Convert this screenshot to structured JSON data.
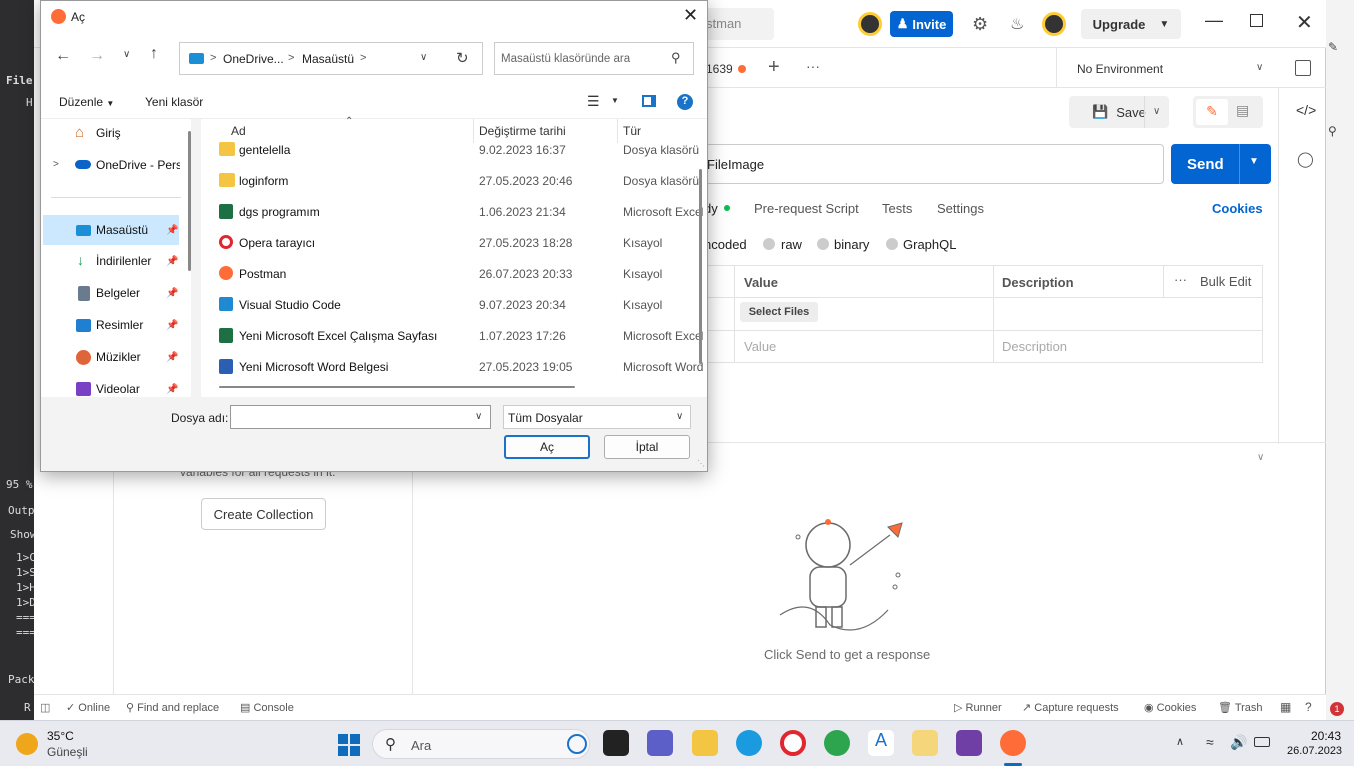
{
  "vs": {
    "file_label": "File",
    "h_label": "H",
    "zoom": "95 %",
    "output_label": "Outp",
    "show_label": "Show",
    "lines": [
      "1>C",
      "1>S",
      "1>H",
      "1>D",
      "===",
      "==="
    ],
    "pack_label": "Pack",
    "r_label": "R"
  },
  "postman": {
    "top_tab_text": "stman",
    "invite_label": "Invite",
    "upgrade_label": "Upgrade",
    "tab_id_text": "1639",
    "environment": "No Environment",
    "save_label": "Save",
    "url_text": "FileImage",
    "send_label": "Send",
    "req_tabs": {
      "body": "dy",
      "prescript": "Pre-request Script",
      "tests": "Tests",
      "settings": "Settings",
      "cookies": "Cookies"
    },
    "body_types": {
      "urlencoded": "ncoded",
      "raw": "raw",
      "binary": "binary",
      "graphql": "GraphQL"
    },
    "table": {
      "value_header": "Value",
      "description_header": "Description",
      "bulk_edit": "Bulk Edit",
      "select_files": "Select Files",
      "value_placeholder": "Value",
      "description_placeholder": "Description"
    },
    "sidebar_text": "variables for all requests in it.",
    "create_collection": "Create Collection",
    "response_hint": "Click Send to get a response",
    "status": {
      "online": "Online",
      "find_replace": "Find and replace",
      "console": "Console",
      "runner": "Runner",
      "capture": "Capture requests",
      "cookies": "Cookies",
      "trash": "Trash"
    }
  },
  "dialog": {
    "title": "Aç",
    "breadcrumb": [
      "OneDrive...",
      "Masaüstü"
    ],
    "search_placeholder": "Masaüstü klasöründe ara",
    "organize": "Düzenle",
    "new_folder": "Yeni klasör",
    "nav": [
      {
        "label": "Giriş",
        "icon": "home-icon",
        "pinned": false
      },
      {
        "label": "OneDrive - Perso",
        "icon": "cloud-icon",
        "pinned": false
      },
      {
        "label": "Masaüstü",
        "icon": "desktop-icon",
        "pinned": true,
        "selected": true
      },
      {
        "label": "İndirilenler",
        "icon": "download-icon",
        "pinned": true
      },
      {
        "label": "Belgeler",
        "icon": "document-icon",
        "pinned": true
      },
      {
        "label": "Resimler",
        "icon": "pictures-icon",
        "pinned": true
      },
      {
        "label": "Müzikler",
        "icon": "music-icon",
        "pinned": true
      },
      {
        "label": "Videolar",
        "icon": "video-icon",
        "pinned": true
      }
    ],
    "columns": {
      "name": "Ad",
      "date": "Değiştirme tarihi",
      "type": "Tür"
    },
    "files": [
      {
        "name": "gentelella",
        "date": "9.02.2023 16:37",
        "type": "Dosya klasörü",
        "icon": "folder-icon"
      },
      {
        "name": "loginform",
        "date": "27.05.2023 20:46",
        "type": "Dosya klasörü",
        "icon": "folder-icon"
      },
      {
        "name": "dgs programım",
        "date": "1.06.2023 21:34",
        "type": "Microsoft Excel",
        "icon": "excel-icon"
      },
      {
        "name": "Opera tarayıcı",
        "date": "27.05.2023 18:28",
        "type": "Kısayol",
        "icon": "opera-icon"
      },
      {
        "name": "Postman",
        "date": "26.07.2023 20:33",
        "type": "Kısayol",
        "icon": "postman-icon"
      },
      {
        "name": "Visual Studio Code",
        "date": "9.07.2023 20:34",
        "type": "Kısayol",
        "icon": "vscode-icon"
      },
      {
        "name": "Yeni Microsoft Excel Çalışma Sayfası",
        "date": "1.07.2023 17:26",
        "type": "Microsoft Excel",
        "icon": "excel-icon"
      },
      {
        "name": "Yeni Microsoft Word Belgesi",
        "date": "27.05.2023 19:05",
        "type": "Microsoft Word",
        "icon": "word-icon"
      }
    ],
    "filename_label": "Dosya adı:",
    "filename_value": "",
    "filter": "Tüm Dosyalar",
    "open_label": "Aç",
    "cancel_label": "İptal"
  },
  "taskbar": {
    "temperature": "35°C",
    "weather": "Güneşli",
    "search_placeholder": "Ara",
    "time": "20:43",
    "date": "26.07.2023"
  },
  "colors": {
    "postman_orange": "#ff6c37",
    "send_blue": "#0265d2",
    "selection": "#cce8ff"
  }
}
